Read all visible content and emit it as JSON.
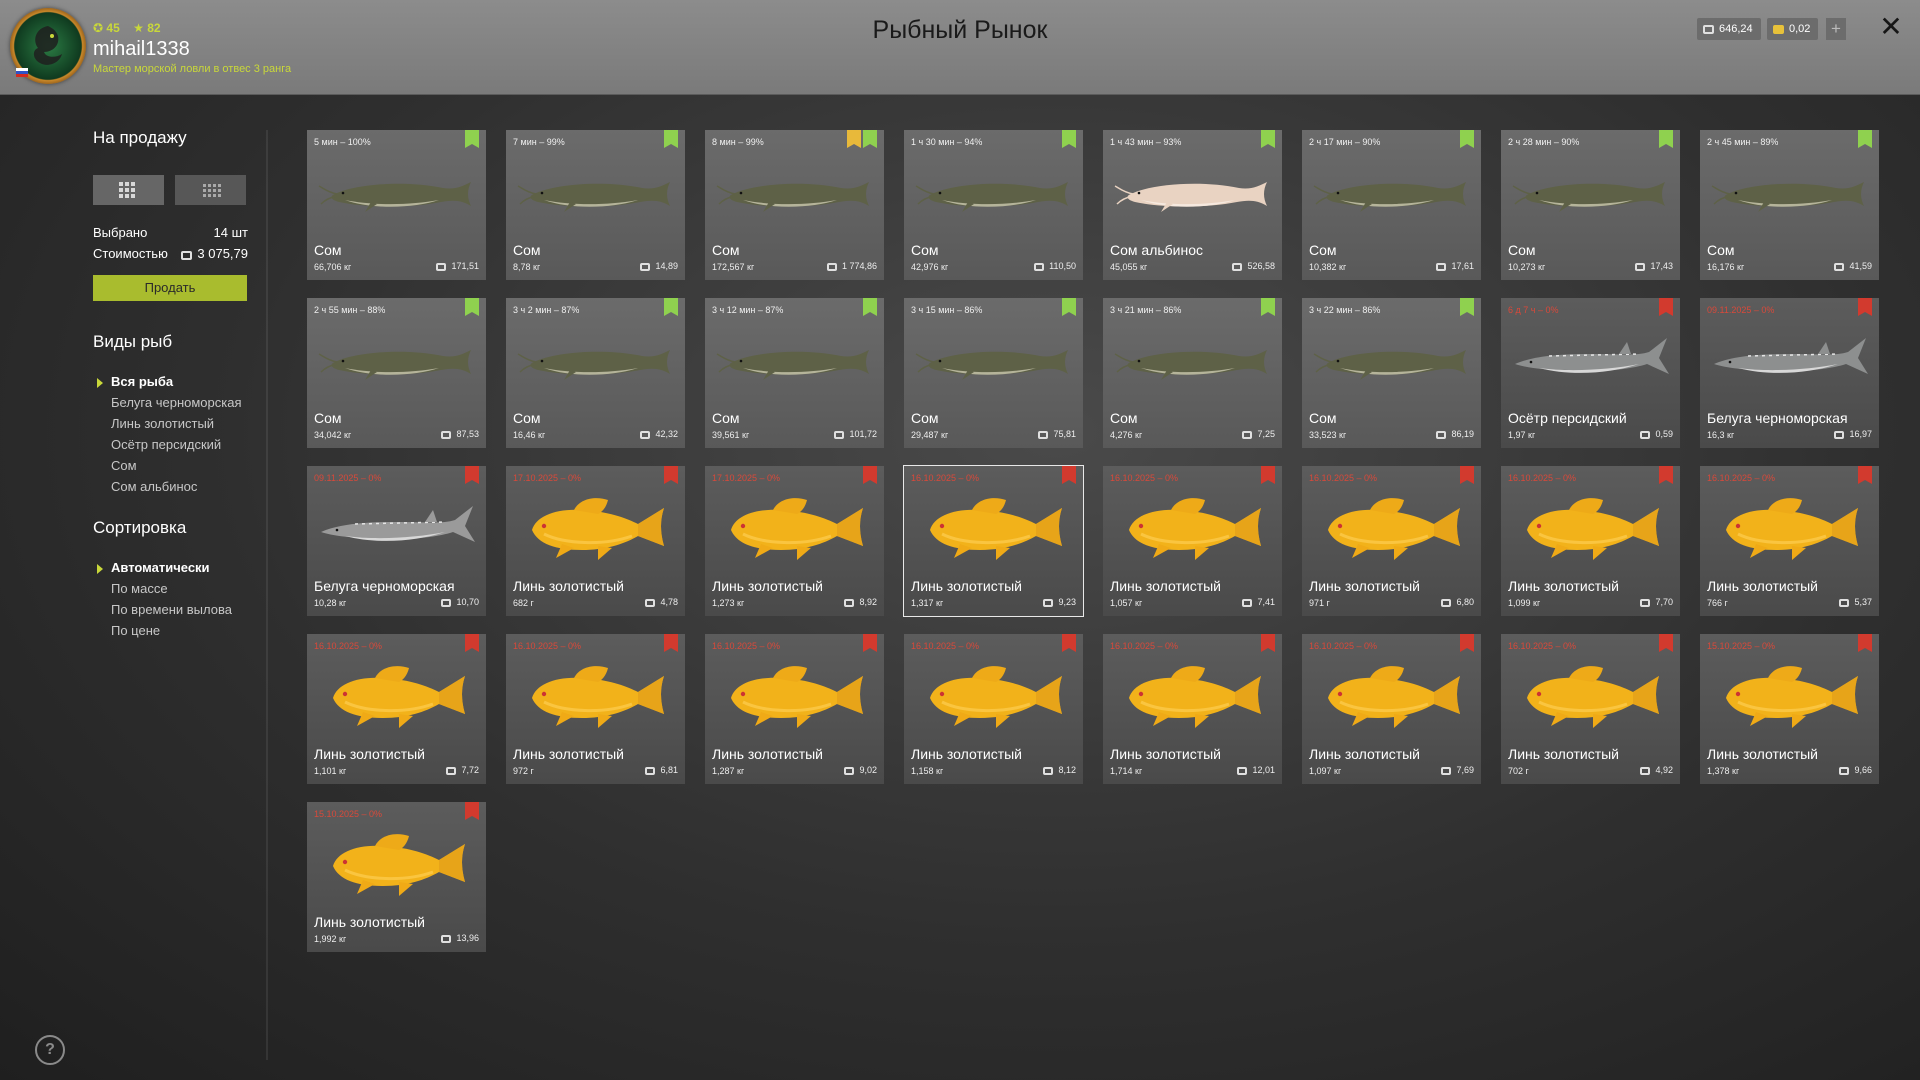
{
  "header": {
    "title": "Рыбный Рынок",
    "level": "45",
    "rating": "82",
    "username": "mihail1338",
    "rank": "Мастер морской ловли в отвес 3 ранга",
    "silver": "646,24",
    "gold": "0,02",
    "plus": "+",
    "close": "✕"
  },
  "sidebar": {
    "for_sale_title": "На продажу",
    "selected_label": "Выбрано",
    "selected_value": "14 шт",
    "cost_label": "Стоимостью",
    "cost_value": "3 075,79",
    "sell_button": "Продать",
    "species_title": "Виды рыб",
    "species": [
      "Вся рыба",
      "Белуга черноморская",
      "Линь золотистый",
      "Осётр персидский",
      "Сом",
      "Сом альбинос"
    ],
    "sort_title": "Сортировка",
    "sort": [
      "Автоматически",
      "По массе",
      "По времени вылова",
      "По цене"
    ],
    "help": "?"
  },
  "fish": [
    {
      "meta": "5 мин – 100%",
      "name": "Сом",
      "weight": "66,706 кг",
      "price": "171,51",
      "kind": "catfish",
      "tag": "green"
    },
    {
      "meta": "7 мин – 99%",
      "name": "Сом",
      "weight": "8,78 кг",
      "price": "14,89",
      "kind": "catfish",
      "tag": "green"
    },
    {
      "meta": "8 мин – 99%",
      "name": "Сом",
      "weight": "172,567 кг",
      "price": "1 774,86",
      "kind": "catfish",
      "tag": "green",
      "gold": true
    },
    {
      "meta": "1 ч 30 мин – 94%",
      "name": "Сом",
      "weight": "42,976 кг",
      "price": "110,50",
      "kind": "catfish",
      "tag": "green"
    },
    {
      "meta": "1 ч 43 мин – 93%",
      "name": "Сом альбинос",
      "weight": "45,055 кг",
      "price": "526,58",
      "kind": "albino",
      "tag": "green"
    },
    {
      "meta": "2 ч 17 мин – 90%",
      "name": "Сом",
      "weight": "10,382 кг",
      "price": "17,61",
      "kind": "catfish",
      "tag": "green"
    },
    {
      "meta": "2 ч 28 мин – 90%",
      "name": "Сом",
      "weight": "10,273 кг",
      "price": "17,43",
      "kind": "catfish",
      "tag": "green"
    },
    {
      "meta": "2 ч 45 мин – 89%",
      "name": "Сом",
      "weight": "16,176 кг",
      "price": "41,59",
      "kind": "catfish",
      "tag": "green"
    },
    {
      "meta": "2 ч 55 мин – 88%",
      "name": "Сом",
      "weight": "34,042 кг",
      "price": "87,53",
      "kind": "catfish",
      "tag": "green"
    },
    {
      "meta": "3 ч 2 мин – 87%",
      "name": "Сом",
      "weight": "16,46 кг",
      "price": "42,32",
      "kind": "catfish",
      "tag": "green"
    },
    {
      "meta": "3 ч 12 мин – 87%",
      "name": "Сом",
      "weight": "39,561 кг",
      "price": "101,72",
      "kind": "catfish",
      "tag": "green"
    },
    {
      "meta": "3 ч 15 мин – 86%",
      "name": "Сом",
      "weight": "29,487 кг",
      "price": "75,81",
      "kind": "catfish",
      "tag": "green"
    },
    {
      "meta": "3 ч 21 мин – 86%",
      "name": "Сом",
      "weight": "4,276 кг",
      "price": "7,25",
      "kind": "catfish",
      "tag": "green"
    },
    {
      "meta": "3 ч 22 мин – 86%",
      "name": "Сом",
      "weight": "33,523 кг",
      "price": "86,19",
      "kind": "catfish",
      "tag": "green"
    },
    {
      "meta": "6 д 7 ч – 0%",
      "name": "Осётр персидский",
      "weight": "1,97 кг",
      "price": "0,59",
      "kind": "sturgeon",
      "tag": "red"
    },
    {
      "meta": "09.11.2025 – 0%",
      "name": "Белуга черноморская",
      "weight": "16,3 кг",
      "price": "16,97",
      "kind": "sturgeon",
      "tag": "red"
    },
    {
      "meta": "09.11.2025 – 0%",
      "name": "Белуга черноморская",
      "weight": "10,28 кг",
      "price": "10,70",
      "kind": "beluga",
      "tag": "red"
    },
    {
      "meta": "17.10.2025 – 0%",
      "name": "Линь золотистый",
      "weight": "682 г",
      "price": "4,78",
      "kind": "tench",
      "tag": "red"
    },
    {
      "meta": "17.10.2025 – 0%",
      "name": "Линь золотистый",
      "weight": "1,273 кг",
      "price": "8,92",
      "kind": "tench",
      "tag": "red"
    },
    {
      "meta": "16.10.2025 – 0%",
      "name": "Линь золотистый",
      "weight": "1,317 кг",
      "price": "9,23",
      "kind": "tench",
      "tag": "red",
      "selected": true
    },
    {
      "meta": "16.10.2025 – 0%",
      "name": "Линь золотистый",
      "weight": "1,057 кг",
      "price": "7,41",
      "kind": "tench",
      "tag": "red"
    },
    {
      "meta": "16.10.2025 – 0%",
      "name": "Линь золотистый",
      "weight": "971 г",
      "price": "6,80",
      "kind": "tench",
      "tag": "red"
    },
    {
      "meta": "16.10.2025 – 0%",
      "name": "Линь золотистый",
      "weight": "1,099 кг",
      "price": "7,70",
      "kind": "tench",
      "tag": "red"
    },
    {
      "meta": "16.10.2025 – 0%",
      "name": "Линь золотистый",
      "weight": "766 г",
      "price": "5,37",
      "kind": "tench",
      "tag": "red"
    },
    {
      "meta": "16.10.2025 – 0%",
      "name": "Линь золотистый",
      "weight": "1,101 кг",
      "price": "7,72",
      "kind": "tench",
      "tag": "red"
    },
    {
      "meta": "16.10.2025 – 0%",
      "name": "Линь золотистый",
      "weight": "972 г",
      "price": "6,81",
      "kind": "tench",
      "tag": "red"
    },
    {
      "meta": "16.10.2025 – 0%",
      "name": "Линь золотистый",
      "weight": "1,287 кг",
      "price": "9,02",
      "kind": "tench",
      "tag": "red"
    },
    {
      "meta": "16.10.2025 – 0%",
      "name": "Линь золотистый",
      "weight": "1,158 кг",
      "price": "8,12",
      "kind": "tench",
      "tag": "red"
    },
    {
      "meta": "16.10.2025 – 0%",
      "name": "Линь золотистый",
      "weight": "1,714 кг",
      "price": "12,01",
      "kind": "tench",
      "tag": "red"
    },
    {
      "meta": "16.10.2025 – 0%",
      "name": "Линь золотистый",
      "weight": "1,097 кг",
      "price": "7,69",
      "kind": "tench",
      "tag": "red"
    },
    {
      "meta": "16.10.2025 – 0%",
      "name": "Линь золотистый",
      "weight": "702 г",
      "price": "4,92",
      "kind": "tench",
      "tag": "red"
    },
    {
      "meta": "15.10.2025 – 0%",
      "name": "Линь золотистый",
      "weight": "1,378 кг",
      "price": "9,66",
      "kind": "tench",
      "tag": "red"
    },
    {
      "meta": "15.10.2025 – 0%",
      "name": "Линь золотистый",
      "weight": "1,992 кг",
      "price": "13,96",
      "kind": "tench",
      "tag": "red"
    }
  ]
}
